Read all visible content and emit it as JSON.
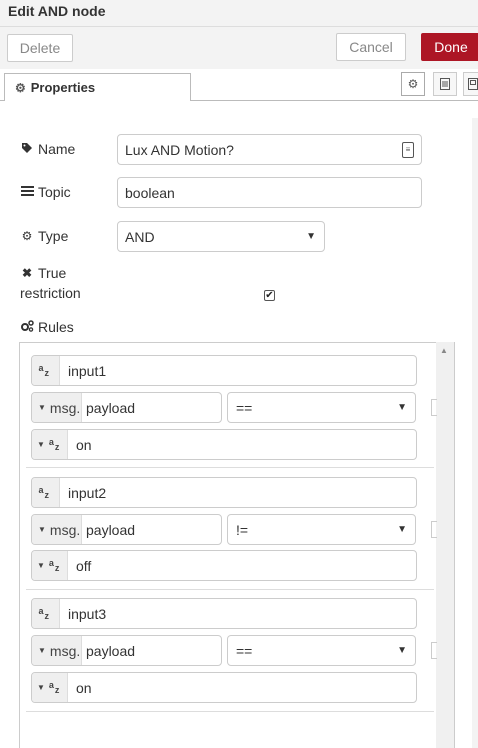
{
  "dialog": {
    "title": "Edit AND node"
  },
  "toolbar": {
    "delete_label": "Delete",
    "cancel_label": "Cancel",
    "done_label": "Done"
  },
  "tabs": {
    "properties_label": "Properties"
  },
  "form": {
    "name_label": "Name",
    "name_value": "Lux AND Motion?",
    "topic_label": "Topic",
    "topic_value": "boolean",
    "type_label": "Type",
    "type_value": "AND",
    "true_restriction_label_1": "True",
    "true_restriction_label_2": "restriction",
    "true_restriction_checked": true,
    "rules_label": "Rules"
  },
  "rules": [
    {
      "name": "input1",
      "prefix": "msg.",
      "property": "payload",
      "operator": "==",
      "value": "on"
    },
    {
      "name": "input2",
      "prefix": "msg.",
      "property": "payload",
      "operator": "!=",
      "value": "off"
    },
    {
      "name": "input3",
      "prefix": "msg.",
      "property": "payload",
      "operator": "==",
      "value": "on"
    }
  ],
  "colors": {
    "done_bg": "#ad1625",
    "header_bg": "#f3f3f3"
  }
}
